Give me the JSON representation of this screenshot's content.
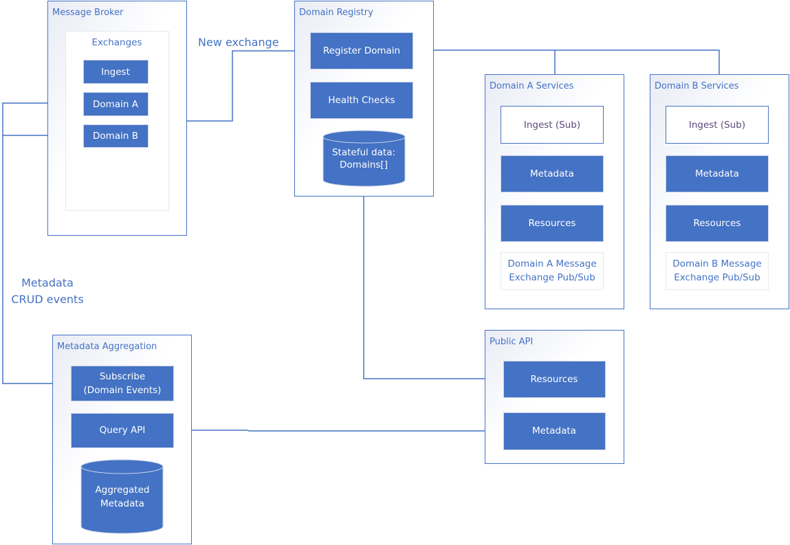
{
  "colors": {
    "accent": "#4472c4",
    "background": "#ffffff"
  },
  "message_broker": {
    "title": "Message Broker",
    "exchanges_title": "Exchanges",
    "exchanges": [
      "Ingest",
      "Domain A",
      "Domain B"
    ]
  },
  "domain_registry": {
    "title": "Domain Registry",
    "register": "Register Domain",
    "health": "Health Checks",
    "store_line1": "Stateful data:",
    "store_line2": "Domains[]"
  },
  "domain_a": {
    "title": "Domain A Services",
    "ingest": "Ingest (Sub)",
    "metadata": "Metadata",
    "resources": "Resources",
    "exchange_line1": "Domain A Message",
    "exchange_line2": "Exchange Pub/Sub"
  },
  "domain_b": {
    "title": "Domain B Services",
    "ingest": "Ingest (Sub)",
    "metadata": "Metadata",
    "resources": "Resources",
    "exchange_line1": "Domain B Message",
    "exchange_line2": "Exchange Pub/Sub"
  },
  "public_api": {
    "title": "Public API",
    "resources": "Resources",
    "metadata": "Metadata"
  },
  "metadata_aggregation": {
    "title": "Metadata Aggregation",
    "subscribe_line1": "Subscribe",
    "subscribe_line2": "(Domain Events)",
    "query": "Query API",
    "store_line1": "Aggregated",
    "store_line2": "Metadata"
  },
  "annotations": {
    "new_exchange": "New exchange",
    "crud_line1": "Metadata",
    "crud_line2": "CRUD events"
  }
}
